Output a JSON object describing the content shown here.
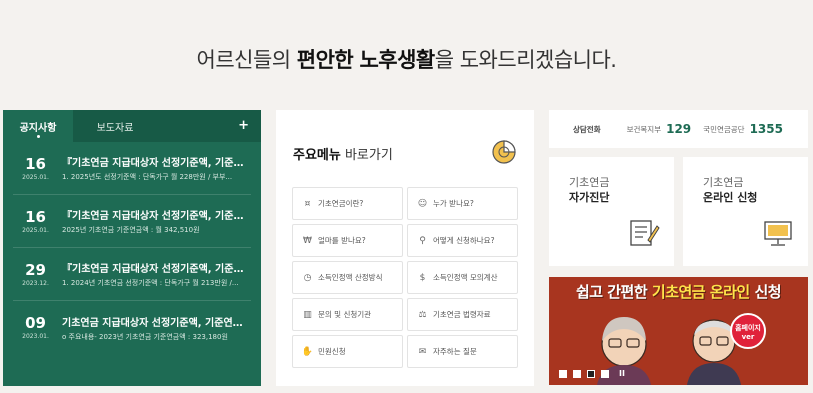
{
  "headline": {
    "pre": "어르신들의 ",
    "bold1": "편안한",
    "mid": " ",
    "bold2": "노후생활",
    "post": "을 도와드리겠습니다."
  },
  "notice": {
    "tab_active": "공지사항",
    "tab_other": "보도자료",
    "more_label": "+",
    "items": [
      {
        "day": "16",
        "ym": "2025.01.",
        "title": "『기초연금 지급대상자 선정기준액, 기준연금...",
        "sub": "1. 2025년도 선정기준액 : 단독가구 월 228만원 / 부부..."
      },
      {
        "day": "16",
        "ym": "2025.01.",
        "title": "『기초연금 지급대상자 선정기준액, 기준연금...",
        "sub": "2025년 기초연금 기준연금액 : 월 342,510원"
      },
      {
        "day": "29",
        "ym": "2023.12.",
        "title": "『기초연금 지급대상자 선정기준액, 기준연금...",
        "sub": "1. 2024년 기초연금 선정기준액 : 단독가구 월 213만원 /..."
      },
      {
        "day": "09",
        "ym": "2023.01.",
        "title": "기초연금 지급대상자 선정기준액, 기준연금액...",
        "sub": "o 주요내용- 2023년 기초연금 기준연금액 : 323,180원"
      }
    ]
  },
  "menu": {
    "title_bold": "주요메뉴",
    "title_rest": " 바로가기",
    "items": [
      {
        "label": "기초연금이란?",
        "icon": "coins-icon"
      },
      {
        "label": "누가 받나요?",
        "icon": "people-icon"
      },
      {
        "label": "얼마를 받나요?",
        "icon": "money-icon"
      },
      {
        "label": "어떻게 신청하나요?",
        "icon": "search-doc-icon"
      },
      {
        "label": "소득인정액 산정방식",
        "icon": "clock-icon"
      },
      {
        "label": "소득인정액 모의계산",
        "icon": "money-bag-icon"
      },
      {
        "label": "문의 및 신청기관",
        "icon": "building-icon"
      },
      {
        "label": "기초연금 법령자료",
        "icon": "law-icon"
      },
      {
        "label": "민원신청",
        "icon": "hand-icon"
      },
      {
        "label": "자주하는 질문",
        "icon": "chat-icon"
      }
    ]
  },
  "call": {
    "label": "상담전화",
    "org1": "보건복지부",
    "num1": "129",
    "org2": "국민연금공단",
    "num2": "1355"
  },
  "cards": [
    {
      "line1": "기초연금",
      "line2": "자가진단",
      "icon": "checklist-icon"
    },
    {
      "line1": "기초연금",
      "line2": "온라인 신청",
      "icon": "computer-icon"
    }
  ],
  "banner": {
    "pre": "쉽고 간편한 ",
    "highlight": "기초연금 온라인",
    "post": " 신청",
    "badge_line1": "홈페이지",
    "badge_line2": "ver",
    "pause_label": "II"
  },
  "colors": {
    "accent": "#1e6b54",
    "banner_bg": "#a8351f",
    "badge": "#e0223a"
  }
}
